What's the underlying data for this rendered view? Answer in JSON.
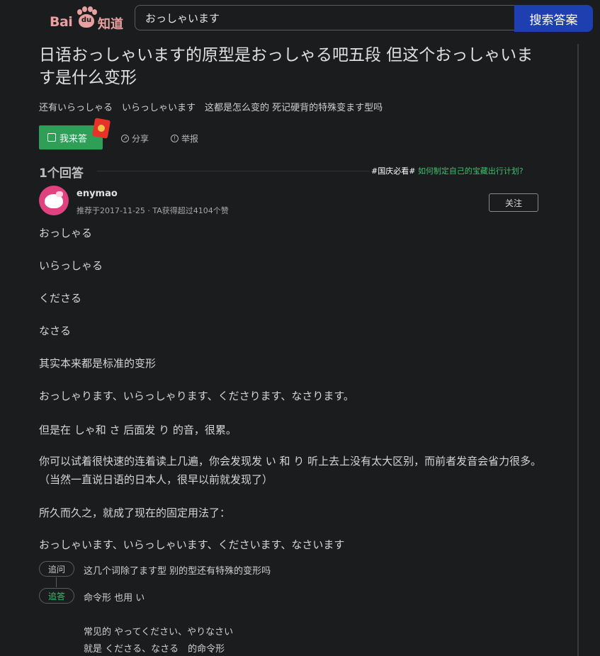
{
  "header": {
    "logo": {
      "bai": "Bai",
      "du": "du",
      "zhidao": "知道"
    },
    "search": {
      "value": "おっしゃいます",
      "button": "搜索答案"
    }
  },
  "question": {
    "title": "日语おっしゃいます的原型是おっしゃる吧五段 但这个おっしゃいます是什么变形",
    "detail": "还有いらっしゃる　いらっしゃいます　这都是怎么变的 死记硬背的特殊变ます型吗",
    "actions": {
      "answer": "我来答",
      "share": "分享",
      "report": "举报"
    }
  },
  "answers_header": {
    "count": "1个回答",
    "promo_tag": "#国庆必看#",
    "promo_link": "如何制定自己的宝藏出行计划?"
  },
  "answer": {
    "user": "enymao",
    "meta": "推荐于2017-11-25 · TA获得超过4104个赞",
    "follow": "关注",
    "paragraphs": [
      "おっしゃる",
      "いらっしゃる",
      "くださる",
      "なさる",
      "其实本来都是标准的变形",
      "おっしゃります、いらっしゃります、くださります、なさります。",
      "但是在 しゃ和 さ 后面发 り 的音，很累。",
      "你可以试着很快速的连着读上几遍，你会发现发 い 和 り 听上去上没有太大区别，而前者发音会省力很多。（当然一直说日语的日本人，很早以前就发现了）",
      "所久而久之，就成了现在的固定用法了：",
      "おっしゃいます、いらっしゃいます、くださいます、なさいます"
    ],
    "followup": {
      "ask_tag": "追问",
      "ask_text": "这几个词除了ます型 别的型还有特殊的变形吗",
      "reply_tag": "追答",
      "reply_text": "命令形 也用 い",
      "reply_line2": "常见的 やってください、やりなさい",
      "reply_line3": "就是 くださる、なさる　的命令形"
    }
  }
}
